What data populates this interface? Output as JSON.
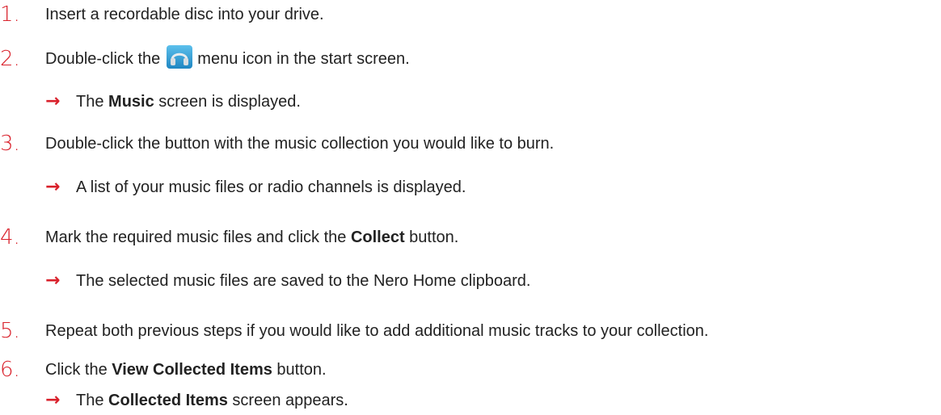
{
  "colors": {
    "step_number": "#d9212b",
    "arrow": "#d9212b",
    "text": "#222222",
    "icon_bg": "#2f9fd6"
  },
  "steps": [
    {
      "number": "1.",
      "text": "Insert a recordable disc into your drive."
    },
    {
      "number": "2.",
      "text_before": "Double-click the",
      "icon": "headphones-icon",
      "text_after": "menu icon in the start screen.",
      "result": {
        "before": "The ",
        "bold": "Music",
        "after": " screen is displayed."
      }
    },
    {
      "number": "3.",
      "text": "Double-click the button with the music collection you would like to burn.",
      "result": {
        "text": "A list of your music files or radio channels is displayed."
      }
    },
    {
      "number": "4.",
      "text_before": "Mark the required music files and click the ",
      "bold": "Collect",
      "text_after": " button.",
      "result": {
        "text": "The selected music files are saved to the Nero Home clipboard."
      }
    },
    {
      "number": "5.",
      "text": "Repeat both previous steps if you would like to add additional music tracks to your collection."
    },
    {
      "number": "6.",
      "text_before": "Click the ",
      "bold": "View Collected Items",
      "text_after": " button.",
      "result": {
        "before": "The ",
        "bold": "Collected Items",
        "after": " screen appears."
      }
    }
  ],
  "arrow_glyph": "→"
}
